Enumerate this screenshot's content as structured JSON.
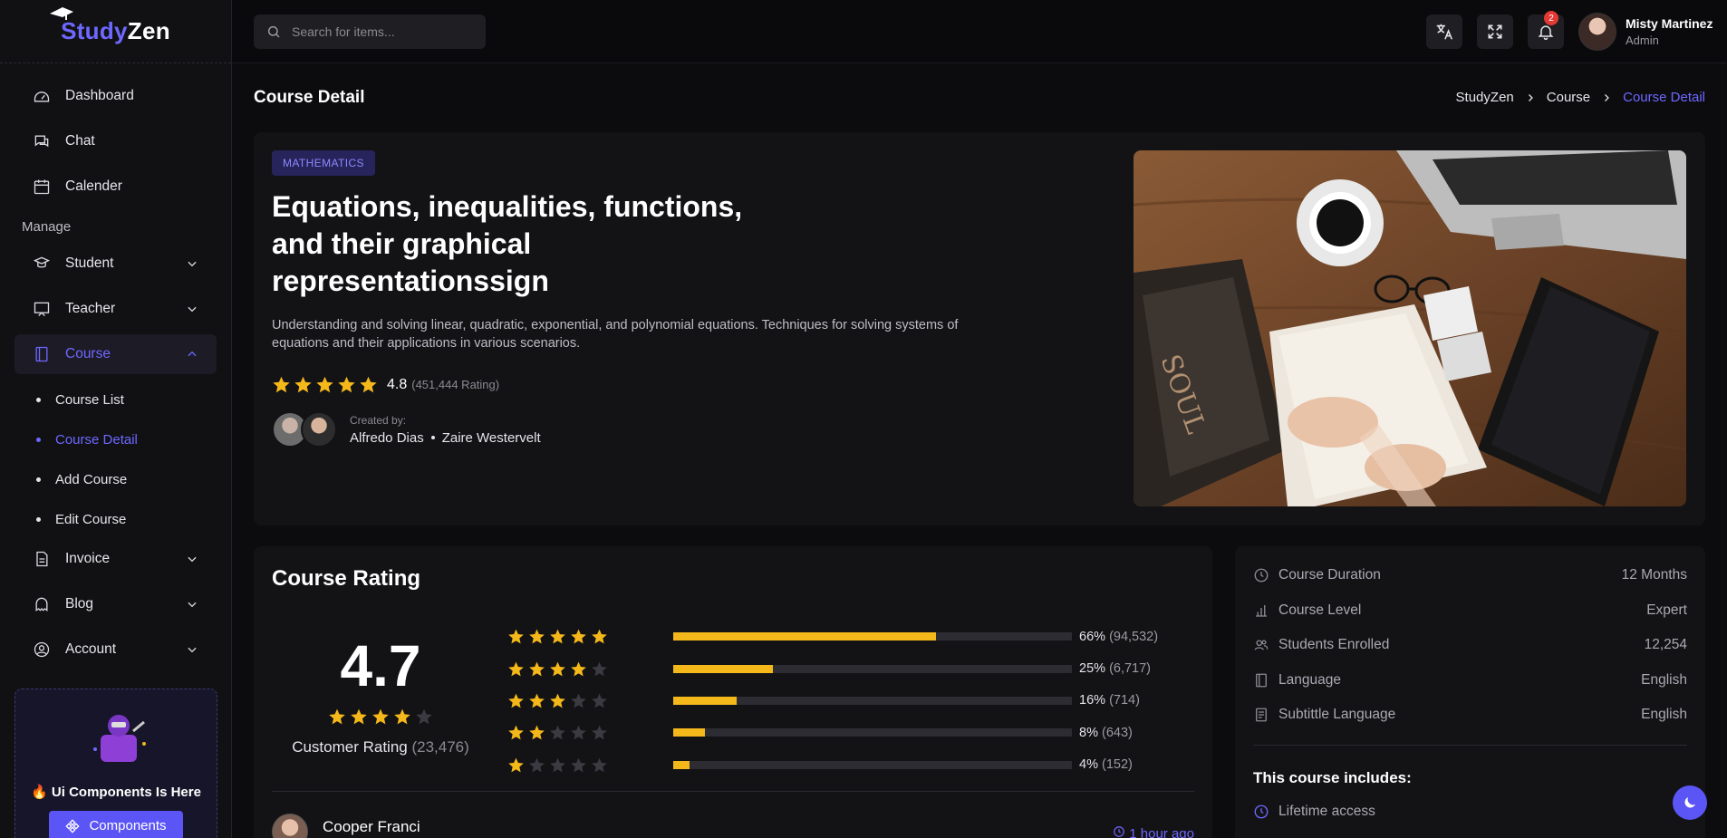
{
  "brand": {
    "prefix": "Study",
    "suffix": "Zen"
  },
  "sidebar": {
    "top_items": [
      {
        "label": "Dashboard"
      },
      {
        "label": "Chat"
      },
      {
        "label": "Calender"
      }
    ],
    "section_label": "Manage",
    "manage_items": [
      {
        "label": "Student"
      },
      {
        "label": "Teacher"
      },
      {
        "label": "Course"
      }
    ],
    "course_sub": [
      {
        "label": "Course List"
      },
      {
        "label": "Course Detail"
      },
      {
        "label": "Add Course"
      },
      {
        "label": "Edit Course"
      }
    ],
    "bottom_items": [
      {
        "label": "Invoice"
      },
      {
        "label": "Blog"
      },
      {
        "label": "Account"
      }
    ],
    "promo": {
      "title": "🔥 Ui Components Is Here",
      "button": "Components"
    }
  },
  "topbar": {
    "search_placeholder": "Search for items...",
    "notification_count": "2",
    "user": {
      "name": "Misty Martinez",
      "role": "Admin"
    }
  },
  "page": {
    "title": "Course Detail",
    "breadcrumb": [
      "StudyZen",
      "Course",
      "Course Detail"
    ]
  },
  "course": {
    "tag": "MATHEMATICS",
    "title": "Equations, inequalities, functions, and their graphical representationssign",
    "description": "Understanding and solving linear, quadratic, exponential, and polynomial equations. Techniques for solving systems of equations and their applications in various scenarios.",
    "rating": "4.8",
    "rating_count": "(451,444 Rating)",
    "created_label": "Created by:",
    "creators": [
      "Alfredo Dias",
      "Zaire Westervelt"
    ]
  },
  "rating_card": {
    "title": "Course Rating",
    "score": "4.7",
    "score_stars": 4,
    "customer_label": "Customer Rating",
    "customer_count": "(23,476)",
    "breakdown": [
      {
        "stars": 5,
        "fill": 0.66,
        "pct": "66%",
        "count": "(94,532)"
      },
      {
        "stars": 4,
        "fill": 0.25,
        "pct": "25%",
        "count": "(6,717)"
      },
      {
        "stars": 3,
        "fill": 0.16,
        "pct": "16%",
        "count": "(714)"
      },
      {
        "stars": 2,
        "fill": 0.08,
        "pct": "8%",
        "count": "(643)"
      },
      {
        "stars": 1,
        "fill": 0.04,
        "pct": "4%",
        "count": "(152)"
      }
    ],
    "reviewer": {
      "name": "Cooper Franci",
      "time": "1 hour ago"
    }
  },
  "info_card": {
    "rows": [
      {
        "label": "Course Duration",
        "value": "12 Months",
        "icon": "clock-icon"
      },
      {
        "label": "Course Level",
        "value": "Expert",
        "icon": "chart-icon"
      },
      {
        "label": "Students Enrolled",
        "value": "12,254",
        "icon": "users-icon"
      },
      {
        "label": "Language",
        "value": "English",
        "icon": "book-icon"
      },
      {
        "label": "Subtittle Language",
        "value": "English",
        "icon": "document-icon"
      }
    ],
    "includes_title": "This course includes:",
    "includes": [
      {
        "label": "Lifetime access",
        "icon": "clock-icon"
      }
    ]
  },
  "colors": {
    "accent": "#6e68ff",
    "star": "#f4b81a",
    "star_empty": "#3a3a40",
    "badge": "#e53935"
  }
}
